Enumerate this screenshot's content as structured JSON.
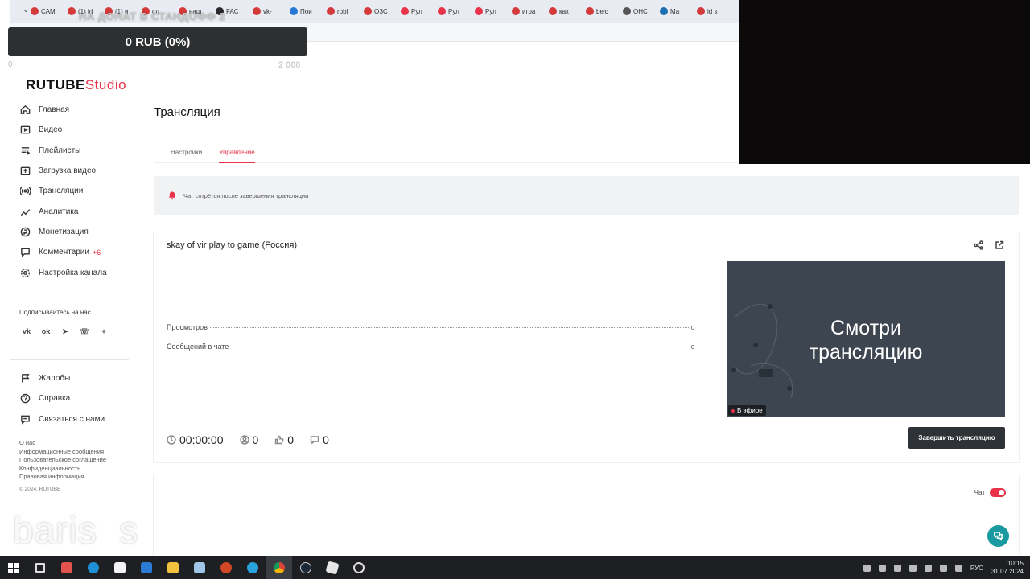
{
  "browser": {
    "tabs": [
      {
        "label": "САМ",
        "color": "#d43a3a"
      },
      {
        "label": "(1) id",
        "color": "#d43a3a"
      },
      {
        "label": "(1) и",
        "color": "#d43a3a"
      },
      {
        "label": "ол",
        "color": "#d43a3a"
      },
      {
        "label": "наш",
        "color": "#d43a3a"
      },
      {
        "label": "FAC",
        "color": "#2b2b2b"
      },
      {
        "label": "vk-",
        "color": "#d43a3a"
      },
      {
        "label": "Пои",
        "color": "#2a78d6"
      },
      {
        "label": "robl",
        "color": "#d43a3a"
      },
      {
        "label": "ОЗС",
        "color": "#d43a3a"
      },
      {
        "label": "Рул",
        "color": "#e8334a"
      },
      {
        "label": "Рул",
        "color": "#e8334a"
      },
      {
        "label": "Рул",
        "color": "#e8334a"
      },
      {
        "label": "игра",
        "color": "#d43a3a"
      },
      {
        "label": "как",
        "color": "#d43a3a"
      },
      {
        "label": "belc",
        "color": "#d43a3a"
      },
      {
        "label": "ОНС",
        "color": "#555555"
      },
      {
        "label": "Ма",
        "color": "#1b6fb0"
      },
      {
        "label": "id s",
        "color": "#d43a3a"
      }
    ]
  },
  "donation": {
    "title": "НА ДОНАТ В СТАНДОФФ 2",
    "amount": "0 RUB (0%)",
    "min": "0",
    "max": "2 000"
  },
  "watermark": {
    "part1": "baris",
    "part2": "s"
  },
  "logo": {
    "part1": "RUTUBE",
    "part2": "Studio"
  },
  "sidebar": {
    "items": [
      {
        "label": "Главная",
        "icon": "home-icon"
      },
      {
        "label": "Видео",
        "icon": "video-icon"
      },
      {
        "label": "Плейлисты",
        "icon": "playlist-icon"
      },
      {
        "label": "Загрузка видео",
        "icon": "upload-icon"
      },
      {
        "label": "Трансляции",
        "icon": "broadcast-icon"
      },
      {
        "label": "Аналитика",
        "icon": "analytics-icon"
      },
      {
        "label": "Монетизация",
        "icon": "monetization-icon"
      },
      {
        "label": "Комментарии",
        "icon": "comments-icon",
        "badge": "+6"
      },
      {
        "label": "Настройка канала",
        "icon": "settings-icon"
      }
    ],
    "subscribe_title": "Подписывайтесь на нас",
    "socials": [
      "vk",
      "ok",
      "telegram",
      "viber",
      "plus"
    ],
    "bottom_items": [
      {
        "label": "Жалобы",
        "icon": "flag-icon"
      },
      {
        "label": "Справка",
        "icon": "help-icon"
      },
      {
        "label": "Связаться с нами",
        "icon": "contact-icon"
      }
    ],
    "footer_links": [
      "О нас",
      "Информационные сообщения",
      "Пользовательское соглашение",
      "Конфиденциальность",
      "Правовая информация"
    ],
    "copyright": "© 2024, RUTUBE"
  },
  "main": {
    "title": "Трансляция",
    "tabs": [
      {
        "label": "Настройки",
        "active": false
      },
      {
        "label": "Управление",
        "active": true
      }
    ],
    "notice": "Чат сотрётся после завершения трансляции",
    "stream": {
      "name": "skay of vir play to game (Россия)",
      "stats": [
        {
          "label": "Просмотров",
          "value": "0"
        },
        {
          "label": "Сообщений в чате",
          "value": "0"
        }
      ],
      "timer": "00:00:00",
      "viewers": "0",
      "likes": "0",
      "dislikes": "0",
      "preview_line1": "Смотри",
      "preview_line2": "трансляцию",
      "live_label": "В эфире",
      "end_button": "Завершить трансляцию"
    },
    "chat_label": "Чат"
  },
  "taskbar": {
    "language": "РУС",
    "time": "10:15",
    "date": "31.07.2024"
  },
  "colors": {
    "accent": "#e8334a",
    "dark_button": "#2f3337",
    "help_fab": "#1a9aa0"
  }
}
